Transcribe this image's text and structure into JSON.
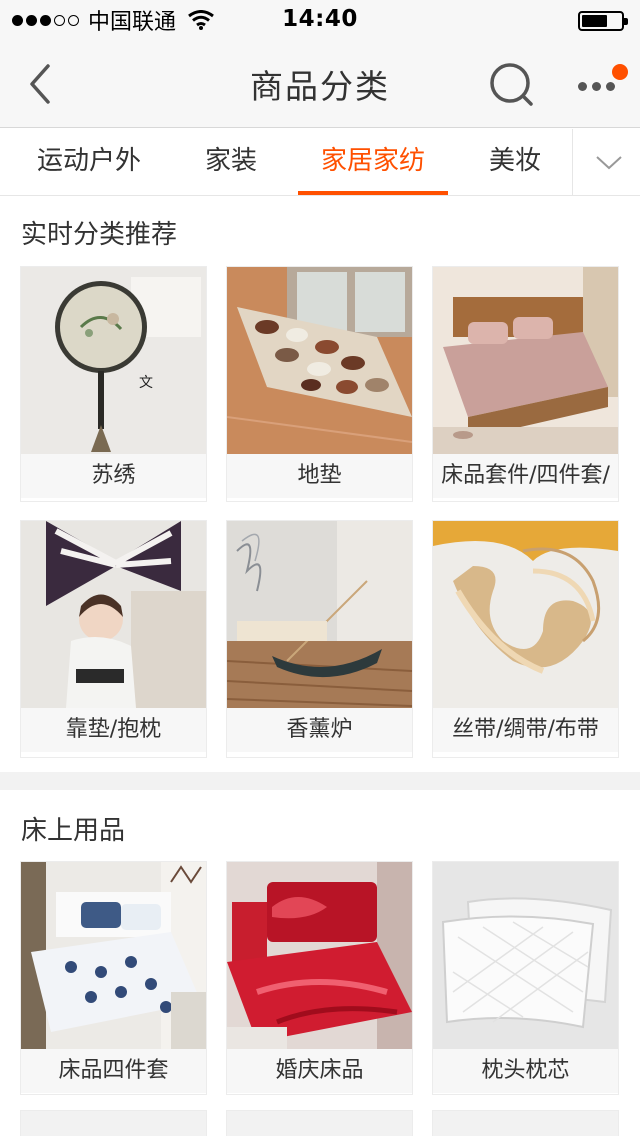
{
  "status_bar": {
    "signal_filled": 3,
    "signal_empty": 2,
    "carrier": "中国联通",
    "time": "14:40",
    "battery_level": 0.65
  },
  "nav": {
    "title": "商品分类",
    "back_icon": "chevron-left-icon",
    "search_icon": "search-icon",
    "more_icon": "more-dots-icon",
    "has_notification": true,
    "accent_color": "#ff5000"
  },
  "tabs": [
    {
      "label": "运动户外",
      "active": false
    },
    {
      "label": "家装",
      "active": false
    },
    {
      "label": "家居家纺",
      "active": true
    },
    {
      "label": "美妆",
      "active": false
    }
  ],
  "sections": [
    {
      "title": "实时分类推荐",
      "items": [
        {
          "label": "苏绣"
        },
        {
          "label": "地垫"
        },
        {
          "label": "床品套件/四件套/"
        },
        {
          "label": "靠垫/抱枕"
        },
        {
          "label": "香薰炉"
        },
        {
          "label": "丝带/绸带/布带"
        }
      ]
    },
    {
      "title": "床上用品",
      "items": [
        {
          "label": "床品四件套"
        },
        {
          "label": "婚庆床品"
        },
        {
          "label": "枕头枕芯"
        }
      ]
    }
  ]
}
